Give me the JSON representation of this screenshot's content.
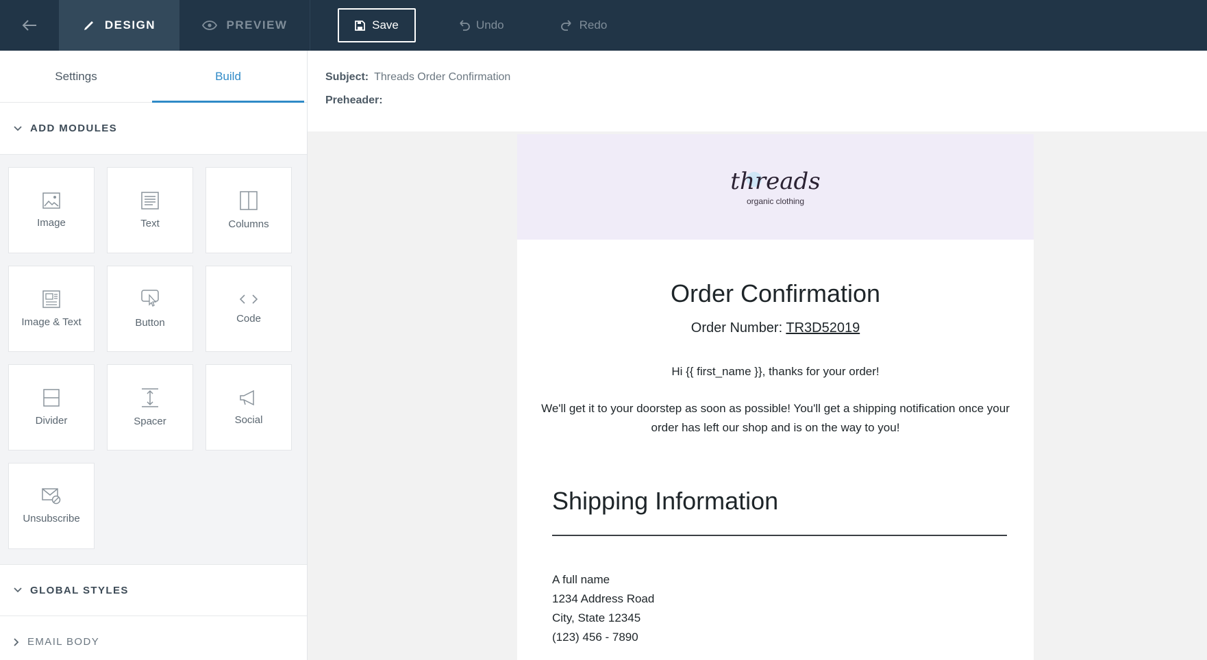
{
  "toolbar": {
    "design_label": "DESIGN",
    "preview_label": "PREVIEW",
    "save_label": "Save",
    "undo_label": "Undo",
    "redo_label": "Redo"
  },
  "sidebar": {
    "tabs": [
      {
        "label": "Settings"
      },
      {
        "label": "Build"
      }
    ],
    "active_tab": "Build",
    "add_modules_label": "ADD MODULES",
    "modules": [
      {
        "label": "Image",
        "icon": "image-icon"
      },
      {
        "label": "Text",
        "icon": "text-icon"
      },
      {
        "label": "Columns",
        "icon": "columns-icon"
      },
      {
        "label": "Image & Text",
        "icon": "image-text-icon"
      },
      {
        "label": "Button",
        "icon": "button-icon"
      },
      {
        "label": "Code",
        "icon": "code-icon"
      },
      {
        "label": "Divider",
        "icon": "divider-icon"
      },
      {
        "label": "Spacer",
        "icon": "spacer-icon"
      },
      {
        "label": "Social",
        "icon": "social-icon"
      },
      {
        "label": "Unsubscribe",
        "icon": "unsubscribe-icon"
      }
    ],
    "global_styles_label": "GLOBAL STYLES",
    "email_body_label": "EMAIL BODY"
  },
  "email_meta": {
    "subject_label": "Subject:",
    "subject_value": "Threads Order Confirmation",
    "preheader_label": "Preheader:",
    "preheader_value": ""
  },
  "email": {
    "logo_text": "threads",
    "logo_subtext": "organic clothing",
    "title": "Order Confirmation",
    "order_number_label": "Order Number:",
    "order_number": "TR3D52019",
    "greeting": "Hi {{ first_name }}, thanks for your order!",
    "message": "We'll get it to your doorstep as soon as possible! You'll get a shipping notification once your order has left our shop and is on the way to you!",
    "shipping_title": "Shipping Information",
    "address_lines": [
      "A full name",
      "1234 Address Road",
      "City, State 12345",
      "(123) 456 - 7890"
    ]
  },
  "colors": {
    "topbar_bg": "#213547",
    "accent": "#2f8ac7",
    "email_header_bg": "#f0ecf8"
  }
}
